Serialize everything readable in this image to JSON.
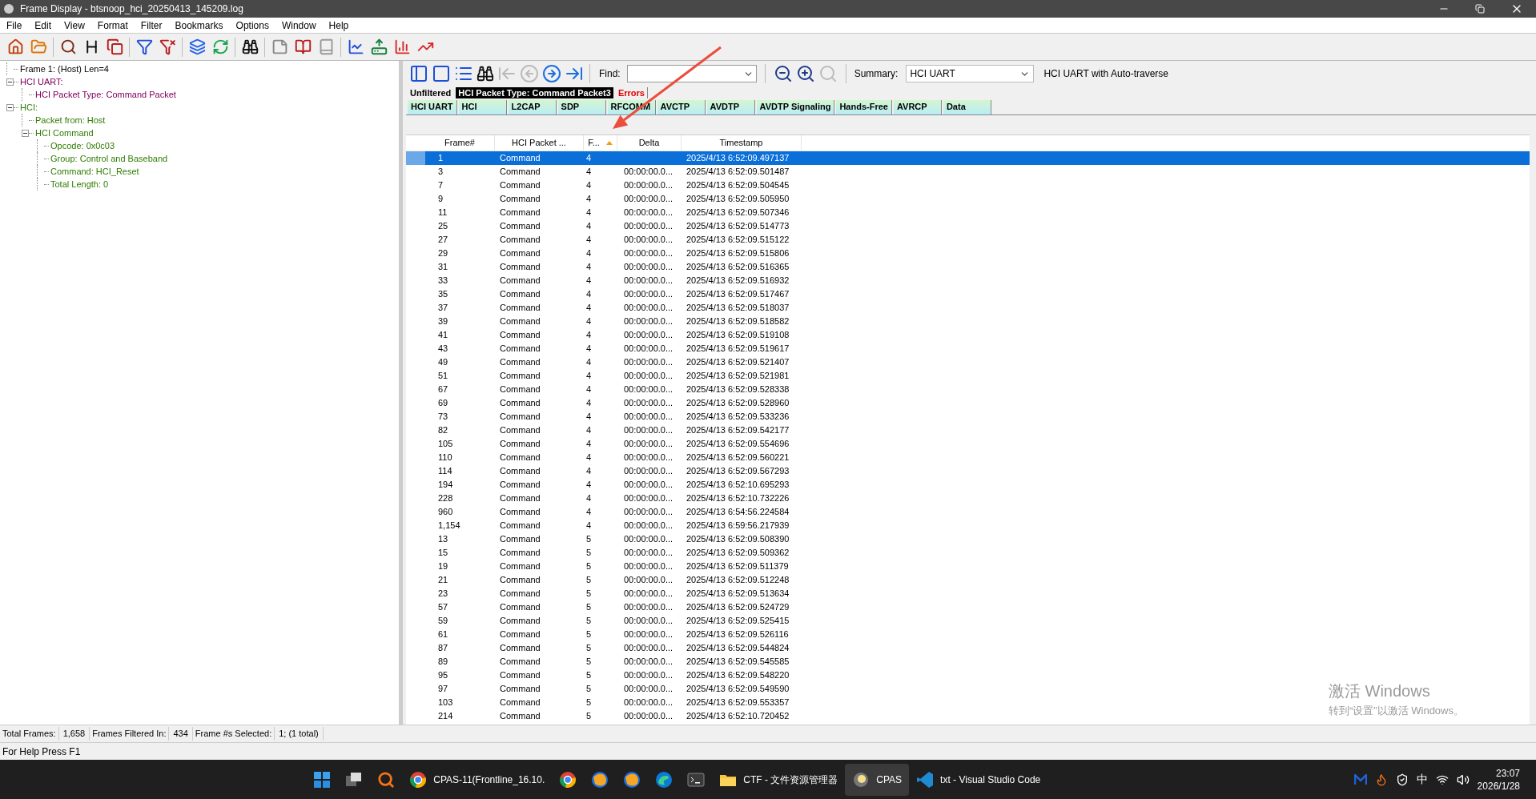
{
  "window": {
    "title": "Frame Display - btsnoop_hci_20250413_145209.log"
  },
  "menu": [
    "File",
    "Edit",
    "View",
    "Format",
    "Filter",
    "Bookmarks",
    "Options",
    "Window",
    "Help"
  ],
  "tree": [
    {
      "label": "Frame 1: (Host) Len=4",
      "color": "#000000"
    },
    {
      "label": "HCI UART:",
      "color": "#800060",
      "expanded": true,
      "children": [
        {
          "label": "HCI Packet Type: Command Packet",
          "color": "#800060"
        }
      ]
    },
    {
      "label": "HCI:",
      "color": "#2e7d00",
      "expanded": true,
      "children": [
        {
          "label": "Packet from: Host",
          "color": "#2e7d00"
        },
        {
          "label": "HCI Command",
          "color": "#2e7d00",
          "expanded": true,
          "children": [
            {
              "label": "Opcode: 0x0c03",
              "color": "#2e7d00"
            },
            {
              "label": "Group: Control and Baseband",
              "color": "#2e7d00"
            },
            {
              "label": "Command: HCI_Reset",
              "color": "#2e7d00"
            },
            {
              "label": "Total Length: 0",
              "color": "#2e7d00"
            }
          ]
        }
      ]
    }
  ],
  "detail_toolbar": {
    "find_label": "Find:",
    "summary_label": "Summary:",
    "summary_value": "HCI UART",
    "summary_note": "HCI UART with Auto-traverse"
  },
  "filter_tabs": [
    {
      "label": "Unfiltered",
      "kind": "plain",
      "selected": false
    },
    {
      "label": "HCI Packet Type: Command Packet3",
      "kind": "filter",
      "selected": true
    },
    {
      "label": "Errors",
      "kind": "errors",
      "selected": false
    }
  ],
  "protocol_tabs": [
    "HCI UART",
    "HCI",
    "L2CAP",
    "SDP",
    "RFCOMM",
    "AVCTP",
    "AVDTP",
    "AVDTP Signaling",
    "Hands-Free",
    "AVRCP",
    "Data"
  ],
  "table": {
    "columns": [
      {
        "label": "Frame#",
        "sorted": false
      },
      {
        "label": "HCI Packet ...",
        "sorted": false
      },
      {
        "label": "F...",
        "sorted": true
      },
      {
        "label": "Delta",
        "sorted": false
      },
      {
        "label": "Timestamp",
        "sorted": false
      }
    ],
    "rows": [
      {
        "frame": "1",
        "type": "Command",
        "f": "4",
        "delta": "",
        "timestamp": "2025/4/13 6:52:09.497137",
        "selected": true
      },
      {
        "frame": "3",
        "type": "Command",
        "f": "4",
        "delta": "00:00:00.0...",
        "timestamp": "2025/4/13 6:52:09.501487",
        "selected": false
      },
      {
        "frame": "7",
        "type": "Command",
        "f": "4",
        "delta": "00:00:00.0...",
        "timestamp": "2025/4/13 6:52:09.504545",
        "selected": false
      },
      {
        "frame": "9",
        "type": "Command",
        "f": "4",
        "delta": "00:00:00.0...",
        "timestamp": "2025/4/13 6:52:09.505950",
        "selected": false
      },
      {
        "frame": "11",
        "type": "Command",
        "f": "4",
        "delta": "00:00:00.0...",
        "timestamp": "2025/4/13 6:52:09.507346",
        "selected": false
      },
      {
        "frame": "25",
        "type": "Command",
        "f": "4",
        "delta": "00:00:00.0...",
        "timestamp": "2025/4/13 6:52:09.514773",
        "selected": false
      },
      {
        "frame": "27",
        "type": "Command",
        "f": "4",
        "delta": "00:00:00.0...",
        "timestamp": "2025/4/13 6:52:09.515122",
        "selected": false
      },
      {
        "frame": "29",
        "type": "Command",
        "f": "4",
        "delta": "00:00:00.0...",
        "timestamp": "2025/4/13 6:52:09.515806",
        "selected": false
      },
      {
        "frame": "31",
        "type": "Command",
        "f": "4",
        "delta": "00:00:00.0...",
        "timestamp": "2025/4/13 6:52:09.516365",
        "selected": false
      },
      {
        "frame": "33",
        "type": "Command",
        "f": "4",
        "delta": "00:00:00.0...",
        "timestamp": "2025/4/13 6:52:09.516932",
        "selected": false
      },
      {
        "frame": "35",
        "type": "Command",
        "f": "4",
        "delta": "00:00:00.0...",
        "timestamp": "2025/4/13 6:52:09.517467",
        "selected": false
      },
      {
        "frame": "37",
        "type": "Command",
        "f": "4",
        "delta": "00:00:00.0...",
        "timestamp": "2025/4/13 6:52:09.518037",
        "selected": false
      },
      {
        "frame": "39",
        "type": "Command",
        "f": "4",
        "delta": "00:00:00.0...",
        "timestamp": "2025/4/13 6:52:09.518582",
        "selected": false
      },
      {
        "frame": "41",
        "type": "Command",
        "f": "4",
        "delta": "00:00:00.0...",
        "timestamp": "2025/4/13 6:52:09.519108",
        "selected": false
      },
      {
        "frame": "43",
        "type": "Command",
        "f": "4",
        "delta": "00:00:00.0...",
        "timestamp": "2025/4/13 6:52:09.519617",
        "selected": false
      },
      {
        "frame": "49",
        "type": "Command",
        "f": "4",
        "delta": "00:00:00.0...",
        "timestamp": "2025/4/13 6:52:09.521407",
        "selected": false
      },
      {
        "frame": "51",
        "type": "Command",
        "f": "4",
        "delta": "00:00:00.0...",
        "timestamp": "2025/4/13 6:52:09.521981",
        "selected": false
      },
      {
        "frame": "67",
        "type": "Command",
        "f": "4",
        "delta": "00:00:00.0...",
        "timestamp": "2025/4/13 6:52:09.528338",
        "selected": false
      },
      {
        "frame": "69",
        "type": "Command",
        "f": "4",
        "delta": "00:00:00.0...",
        "timestamp": "2025/4/13 6:52:09.528960",
        "selected": false
      },
      {
        "frame": "73",
        "type": "Command",
        "f": "4",
        "delta": "00:00:00.0...",
        "timestamp": "2025/4/13 6:52:09.533236",
        "selected": false
      },
      {
        "frame": "82",
        "type": "Command",
        "f": "4",
        "delta": "00:00:00.0...",
        "timestamp": "2025/4/13 6:52:09.542177",
        "selected": false
      },
      {
        "frame": "105",
        "type": "Command",
        "f": "4",
        "delta": "00:00:00.0...",
        "timestamp": "2025/4/13 6:52:09.554696",
        "selected": false
      },
      {
        "frame": "110",
        "type": "Command",
        "f": "4",
        "delta": "00:00:00.0...",
        "timestamp": "2025/4/13 6:52:09.560221",
        "selected": false
      },
      {
        "frame": "114",
        "type": "Command",
        "f": "4",
        "delta": "00:00:00.0...",
        "timestamp": "2025/4/13 6:52:09.567293",
        "selected": false
      },
      {
        "frame": "194",
        "type": "Command",
        "f": "4",
        "delta": "00:00:00.0...",
        "timestamp": "2025/4/13 6:52:10.695293",
        "selected": false
      },
      {
        "frame": "228",
        "type": "Command",
        "f": "4",
        "delta": "00:00:00.0...",
        "timestamp": "2025/4/13 6:52:10.732226",
        "selected": false
      },
      {
        "frame": "960",
        "type": "Command",
        "f": "4",
        "delta": "00:00:00.0...",
        "timestamp": "2025/4/13 6:54:56.224584",
        "selected": false
      },
      {
        "frame": "1,154",
        "type": "Command",
        "f": "4",
        "delta": "00:00:00.0...",
        "timestamp": "2025/4/13 6:59:56.217939",
        "selected": false
      },
      {
        "frame": "13",
        "type": "Command",
        "f": "5",
        "delta": "00:00:00.0...",
        "timestamp": "2025/4/13 6:52:09.508390",
        "selected": false
      },
      {
        "frame": "15",
        "type": "Command",
        "f": "5",
        "delta": "00:00:00.0...",
        "timestamp": "2025/4/13 6:52:09.509362",
        "selected": false
      },
      {
        "frame": "19",
        "type": "Command",
        "f": "5",
        "delta": "00:00:00.0...",
        "timestamp": "2025/4/13 6:52:09.511379",
        "selected": false
      },
      {
        "frame": "21",
        "type": "Command",
        "f": "5",
        "delta": "00:00:00.0...",
        "timestamp": "2025/4/13 6:52:09.512248",
        "selected": false
      },
      {
        "frame": "23",
        "type": "Command",
        "f": "5",
        "delta": "00:00:00.0...",
        "timestamp": "2025/4/13 6:52:09.513634",
        "selected": false
      },
      {
        "frame": "57",
        "type": "Command",
        "f": "5",
        "delta": "00:00:00.0...",
        "timestamp": "2025/4/13 6:52:09.524729",
        "selected": false
      },
      {
        "frame": "59",
        "type": "Command",
        "f": "5",
        "delta": "00:00:00.0...",
        "timestamp": "2025/4/13 6:52:09.525415",
        "selected": false
      },
      {
        "frame": "61",
        "type": "Command",
        "f": "5",
        "delta": "00:00:00.0...",
        "timestamp": "2025/4/13 6:52:09.526116",
        "selected": false
      },
      {
        "frame": "87",
        "type": "Command",
        "f": "5",
        "delta": "00:00:00.0...",
        "timestamp": "2025/4/13 6:52:09.544824",
        "selected": false
      },
      {
        "frame": "89",
        "type": "Command",
        "f": "5",
        "delta": "00:00:00.0...",
        "timestamp": "2025/4/13 6:52:09.545585",
        "selected": false
      },
      {
        "frame": "95",
        "type": "Command",
        "f": "5",
        "delta": "00:00:00.0...",
        "timestamp": "2025/4/13 6:52:09.548220",
        "selected": false
      },
      {
        "frame": "97",
        "type": "Command",
        "f": "5",
        "delta": "00:00:00.0...",
        "timestamp": "2025/4/13 6:52:09.549590",
        "selected": false
      },
      {
        "frame": "103",
        "type": "Command",
        "f": "5",
        "delta": "00:00:00.0...",
        "timestamp": "2025/4/13 6:52:09.553357",
        "selected": false
      },
      {
        "frame": "214",
        "type": "Command",
        "f": "5",
        "delta": "00:00:00.0...",
        "timestamp": "2025/4/13 6:52:10.720452",
        "selected": false
      }
    ]
  },
  "activation": {
    "title": "激活 Windows",
    "subtitle": "转到“设置”以激活 Windows。"
  },
  "status_bar": [
    {
      "label": "Total Frames:",
      "value": "1,658"
    },
    {
      "label": "Frames Filtered In:",
      "value": "434"
    },
    {
      "label": "Frame #s Selected:",
      "value": "1; (1 total)"
    }
  ],
  "help_text": "For Help Press F1",
  "taskbar": {
    "apps": [
      {
        "kind": "start"
      },
      {
        "kind": "taskview"
      },
      {
        "kind": "search"
      },
      {
        "kind": "browser",
        "label": "CPAS-11(Frontline_16.10.",
        "selected": false
      },
      {
        "kind": "browser",
        "selected": false
      },
      {
        "kind": "fox",
        "selected": false
      },
      {
        "kind": "fox",
        "selected": false
      },
      {
        "kind": "edge",
        "selected": false
      },
      {
        "kind": "terminal",
        "selected": false
      },
      {
        "kind": "folder",
        "label": "CTF - 文件资源管理器",
        "selected": false
      },
      {
        "kind": "app",
        "label": "CPAS",
        "selected": true
      },
      {
        "kind": "code",
        "label": "txt - Visual Studio Code",
        "selected": false
      }
    ],
    "ime": "中",
    "time": "23:07",
    "date": "2026/1/28"
  }
}
